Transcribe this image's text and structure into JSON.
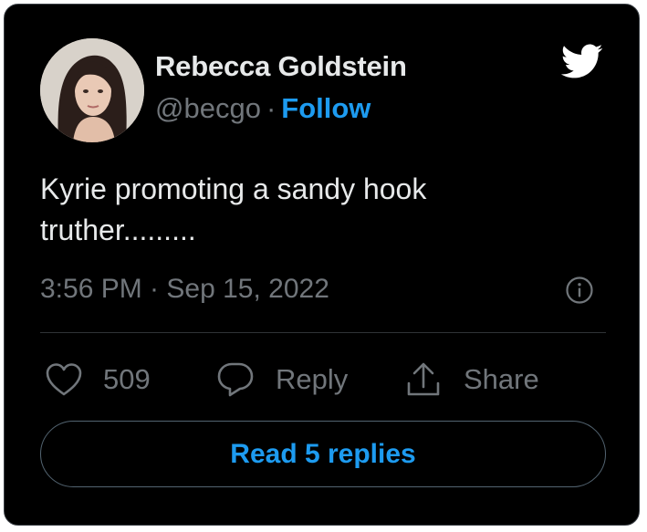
{
  "author": {
    "display_name": "Rebecca Goldstein",
    "handle": "@becgo",
    "separator": "·",
    "follow_label": "Follow"
  },
  "tweet": {
    "text_lines": [
      "Kyrie promoting a sandy hook",
      "truther........."
    ],
    "timestamp": "3:56 PM · Sep 15, 2022"
  },
  "actions": {
    "like_count": "509",
    "reply_label": "Reply",
    "share_label": "Share"
  },
  "read_replies_label": "Read 5 replies",
  "colors": {
    "background": "#000000",
    "text": "#e7e9ea",
    "secondary_text": "#71767b",
    "accent": "#1d9bf0"
  },
  "icons": [
    "twitter-bird-icon",
    "info-icon",
    "heart-icon",
    "reply-bubble-icon",
    "share-icon"
  ]
}
